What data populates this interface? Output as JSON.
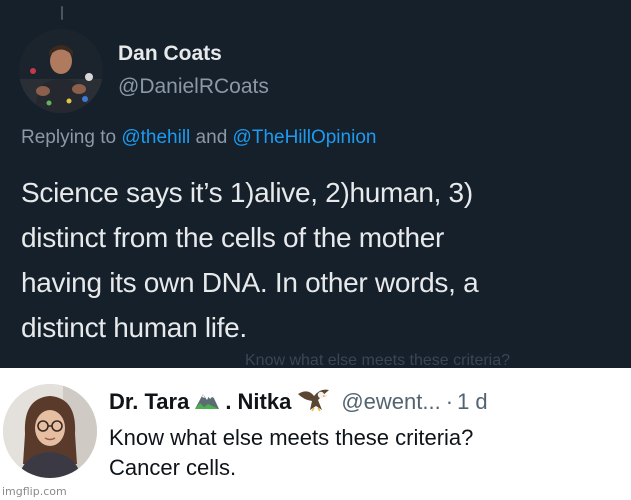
{
  "top_tweet": {
    "author": {
      "display_name": "Dan Coats",
      "handle": "@DanielRCoats"
    },
    "reply": {
      "prefix": "Replying to ",
      "mention_1": "@thehill",
      "connector": " and ",
      "mention_2": "@TheHillOpinion"
    },
    "body_lines": [
      "Science says it’s 1)alive, 2)human, 3)",
      "distinct from the cells of the mother",
      "having its own DNA. In other words, a",
      "distinct human life."
    ],
    "ghost_caption": "Know what else meets these criteria?"
  },
  "bottom_tweet": {
    "name_part_1": "Dr. Tara",
    "name_part_2": ". Nitka",
    "emoji_1": "mountain-emoji",
    "emoji_2": "eagle-emoji",
    "handle": "@ewent...",
    "separator": "·",
    "time": "1 d",
    "body_lines": [
      "Know what else meets these criteria?",
      "Cancer cells."
    ]
  },
  "watermark": "imgflip.com",
  "colors": {
    "dark_bg": "#15202b",
    "dark_text": "#e7e9ea",
    "dark_muted": "#8b98a5",
    "link": "#1d9bf0",
    "light_text": "#0f1419",
    "light_muted": "#536471"
  }
}
